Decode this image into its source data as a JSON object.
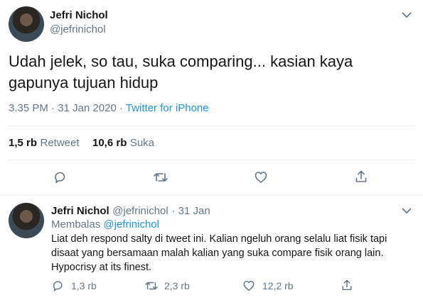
{
  "tweet": {
    "author_name": "Jefri Nichol",
    "author_handle": "@jefrinichol",
    "text_line1": "Udah jelek, so tau, suka comparing... kasian kaya",
    "text_line2": "gapunya tujuan hidup",
    "time": "3.35 PM",
    "sep1": "·",
    "date": "31 Jan 2020",
    "sep2": "·",
    "source": "Twitter for iPhone",
    "retweets_count": "1,5 rb",
    "retweets_label": "Retweet",
    "likes_count": "10,6 rb",
    "likes_label": "Suka",
    "icons": [
      "reply-icon",
      "retweet-icon",
      "like-icon",
      "share-icon"
    ]
  },
  "reply": {
    "author_name": "Jefri Nichol",
    "author_handle": "@jefrinichol",
    "sep": "·",
    "date": "31 Jan",
    "replying_prefix": "Membalas",
    "replying_to": "@jefrinichol",
    "text_line1": "Liat deh respond salty di tweet ini. Kalian ngeluh orang selalu liat fisik tapi",
    "text_line2": "disaat yang bersamaan malah kalian yang suka compare fisik orang lain.",
    "text_line3": "Hypocrisy at its finest.",
    "reply_count": "1,3 rb",
    "retweet_count": "2,3 rb",
    "like_count": "12,2 rb"
  },
  "colors": {
    "text": "#14171a",
    "muted": "#657786",
    "link": "#1b95e0",
    "divider": "#e6ecf0"
  }
}
